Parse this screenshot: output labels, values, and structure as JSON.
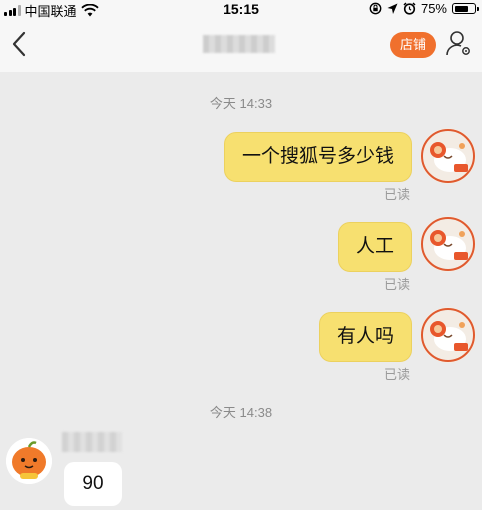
{
  "status_bar": {
    "carrier": "中国联通",
    "time": "15:15",
    "battery_percent": "75%",
    "battery_level": 0.75,
    "icons": [
      "signal-icon",
      "wifi-icon",
      "lock-rotation-icon",
      "location-icon",
      "alarm-icon",
      "battery-icon"
    ]
  },
  "nav": {
    "back_icon": "chevron-left-icon",
    "shop_label": "店铺",
    "profile_icon": "person-settings-icon",
    "accent": "#f0702d"
  },
  "chat": {
    "timestamp_1": "今天 14:33",
    "messages_me": [
      {
        "text": "一个搜狐号多少钱",
        "status": "已读"
      },
      {
        "text": "人工",
        "status": "已读"
      },
      {
        "text": "有人吗",
        "status": "已读"
      }
    ],
    "timestamp_2": "今天 14:38",
    "reply": {
      "text": "90"
    }
  },
  "colors": {
    "bubble_me": "#f7e070",
    "bubble_them": "#ffffff",
    "background": "#ebebeb"
  }
}
